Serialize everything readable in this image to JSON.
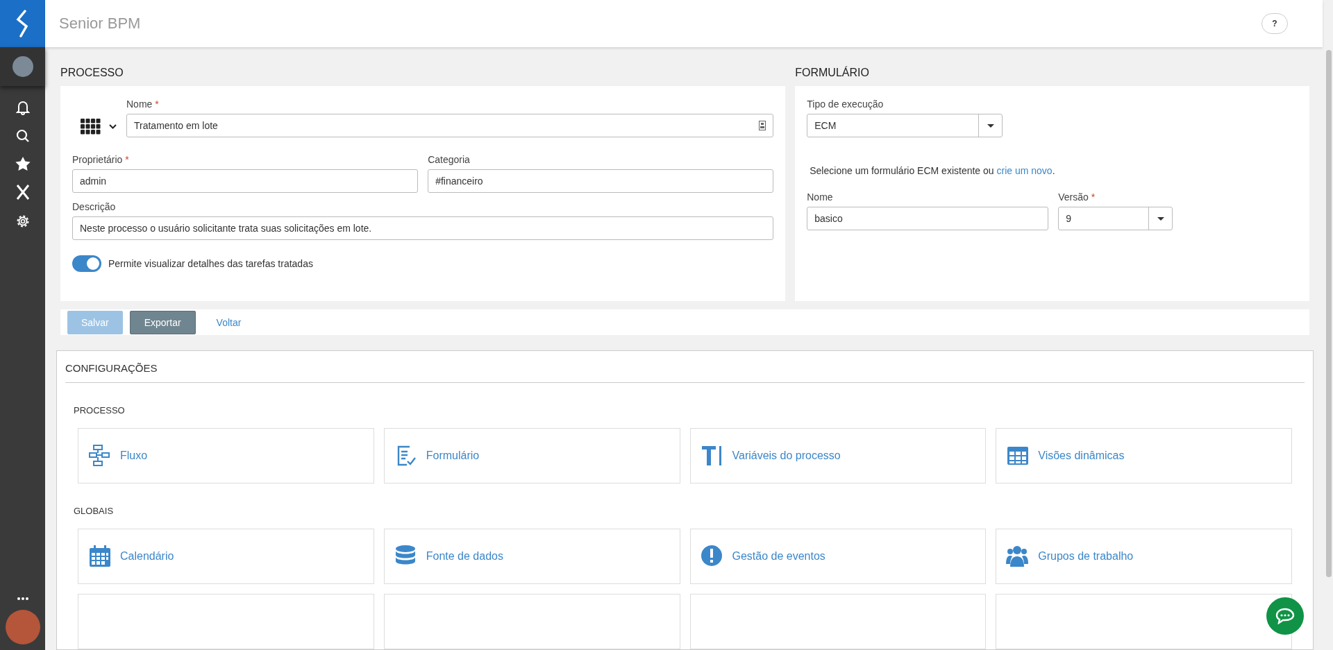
{
  "header": {
    "title": "Senior BPM",
    "help": "?"
  },
  "processo": {
    "heading": "PROCESSO",
    "fields": [
      {
        "label": "Nome",
        "required_mark": "*",
        "value": "Tratamento em lote"
      },
      {
        "label": "Proprietário",
        "required_mark": "*",
        "value": "admin"
      },
      {
        "label": "Categoria",
        "value": "#financeiro"
      },
      {
        "label": "Descrição",
        "value": "Neste processo o usuário solicitante trata suas solicitações em lote."
      }
    ],
    "toggle": {
      "label": "Permite visualizar detalhes das tarefas tratadas",
      "on": true
    }
  },
  "formulario": {
    "heading": "FORMULÁRIO",
    "tipo": {
      "label": "Tipo de execução",
      "value": "ECM"
    },
    "hint": "Selecione um formulário ECM existente ou ",
    "link": "crie um novo",
    "hint_end": ".",
    "nome": {
      "label": "Nome",
      "value": "basico"
    },
    "versao": {
      "label": "Versão",
      "required_mark": "*",
      "value": "9"
    }
  },
  "actions": [
    {
      "label": "Salvar",
      "kind": "primary",
      "disabled": true
    },
    {
      "label": "Exportar",
      "kind": "secondary",
      "disabled": false
    },
    {
      "label": "Voltar",
      "kind": "link",
      "disabled": false
    }
  ],
  "configuracoes": {
    "heading": "CONFIGURAÇÕES",
    "groups": [
      {
        "title": "PROCESSO",
        "tiles": [
          "Fluxo",
          "Formulário",
          "Variáveis do processo",
          "Visões dinâmicas"
        ]
      },
      {
        "title": "GLOBAIS",
        "tiles": [
          "Calendário",
          "Fonte de dados",
          "Gestão de eventos",
          "Grupos de trabalho"
        ]
      }
    ]
  }
}
